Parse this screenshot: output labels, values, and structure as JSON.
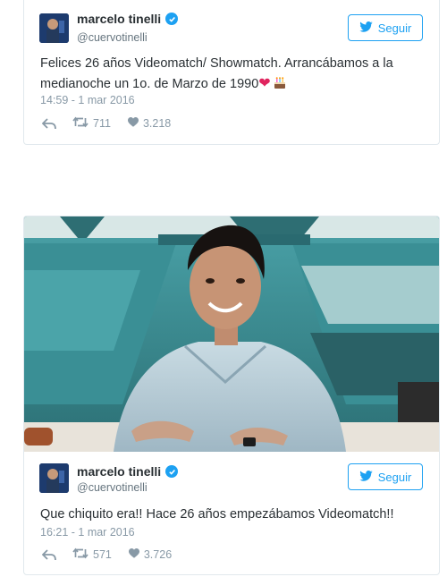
{
  "tweets": [
    {
      "name": "marcelo tinelli",
      "handle": "@cuervotinelli",
      "follow_label": "Seguir",
      "text": "Felices 26 años Videomatch/ Showmatch. Arrancábamos a la medianoche un 1o. de Marzo de 1990",
      "emoji_heart": "❤",
      "timestamp": "14:59 - 1 mar 2016",
      "retweets": "711",
      "likes": "3.218"
    },
    {
      "name": "marcelo tinelli",
      "handle": "@cuervotinelli",
      "follow_label": "Seguir",
      "text": "Que chiquito era!! Hace 26 años empezábamos Videomatch!!",
      "timestamp": "16:21 - 1 mar 2016",
      "retweets": "571",
      "likes": "3.726"
    }
  ],
  "colors": {
    "twitter_blue": "#1da1f2",
    "meta_gray": "#8899a6",
    "heart_red": "#e0245e"
  },
  "icons": [
    "verified-icon",
    "twitter-bird-icon",
    "reply-icon",
    "retweet-icon",
    "like-icon",
    "cake-icon"
  ]
}
